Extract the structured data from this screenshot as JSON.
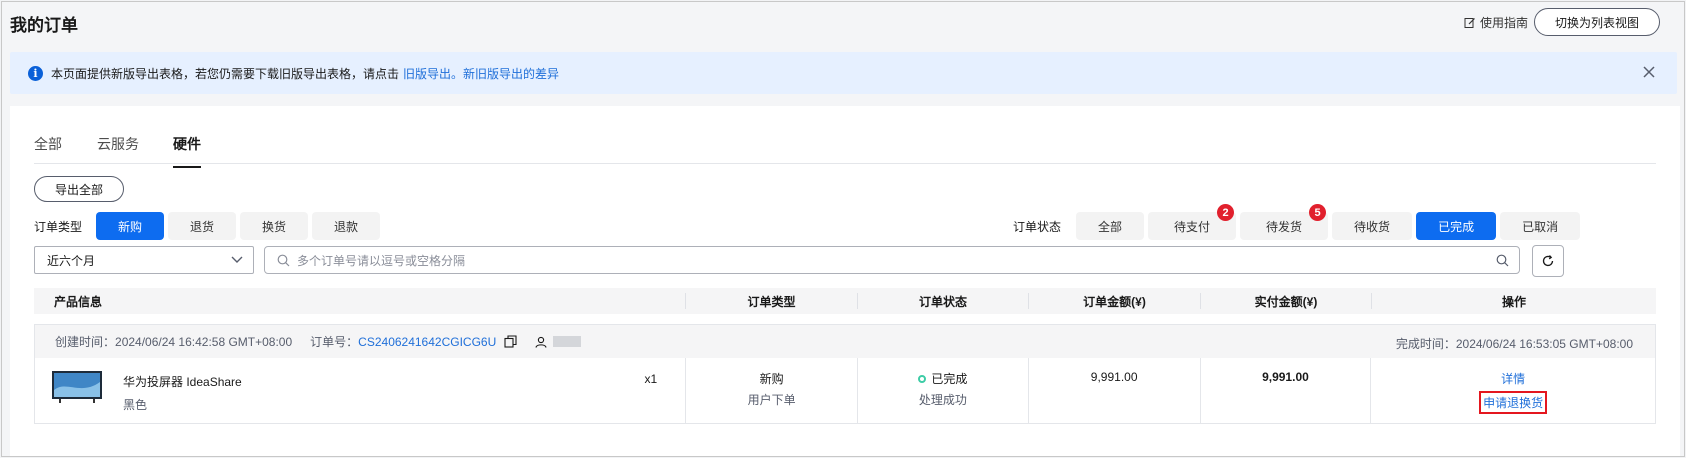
{
  "header": {
    "title": "我的订单",
    "guide_label": "使用指南",
    "switch_view_label": "切换为列表视图"
  },
  "notice": {
    "text": "本页面提供新版导出表格，若您仍需要下载旧版导出表格，请点击",
    "link_old": "旧版导出。",
    "link_diff": "新旧版导出的差异"
  },
  "tabs": [
    {
      "label": "全部",
      "active": false
    },
    {
      "label": "云服务",
      "active": false
    },
    {
      "label": "硬件",
      "active": true
    }
  ],
  "export_all_label": "导出全部",
  "order_type_filter": {
    "label": "订单类型",
    "options": [
      {
        "label": "新购",
        "active": true
      },
      {
        "label": "退货",
        "active": false
      },
      {
        "label": "换货",
        "active": false
      },
      {
        "label": "退款",
        "active": false
      }
    ]
  },
  "order_status_filter": {
    "label": "订单状态",
    "options": [
      {
        "label": "全部",
        "active": false,
        "badge": null
      },
      {
        "label": "待支付",
        "active": false,
        "badge": "2"
      },
      {
        "label": "待发货",
        "active": false,
        "badge": "5"
      },
      {
        "label": "待收货",
        "active": false,
        "badge": null
      },
      {
        "label": "已完成",
        "active": true,
        "badge": null
      },
      {
        "label": "已取消",
        "active": false,
        "badge": null
      }
    ]
  },
  "time_select": {
    "value": "近六个月"
  },
  "search": {
    "placeholder": "多个订单号请以逗号或空格分隔"
  },
  "table": {
    "columns": [
      "产品信息",
      "订单类型",
      "订单状态",
      "订单金额(¥)",
      "实付金额(¥)",
      "操作"
    ]
  },
  "order": {
    "created_label": "创建时间：",
    "created_value": "2024/06/24 16:42:58 GMT+08:00",
    "order_no_label": "订单号：",
    "order_no": "CS2406241642CGICG6U",
    "finished_label": "完成时间：",
    "finished_value": "2024/06/24 16:53:05 GMT+08:00",
    "product_name": "华为投屏器 IdeaShare",
    "product_color": "黑色",
    "quantity": "x1",
    "order_type": "新购",
    "order_type_sub": "用户下单",
    "status": "已完成",
    "status_sub": "处理成功",
    "amount": "9,991.00",
    "paid_amount": "9,991.00",
    "action_detail": "详情",
    "action_return": "申请退换货"
  },
  "colors": {
    "primary": "#0d6cf0",
    "link": "#1f6fd9",
    "badge": "#e1202d",
    "success": "#3dcca6",
    "highlight": "#e4171f"
  }
}
